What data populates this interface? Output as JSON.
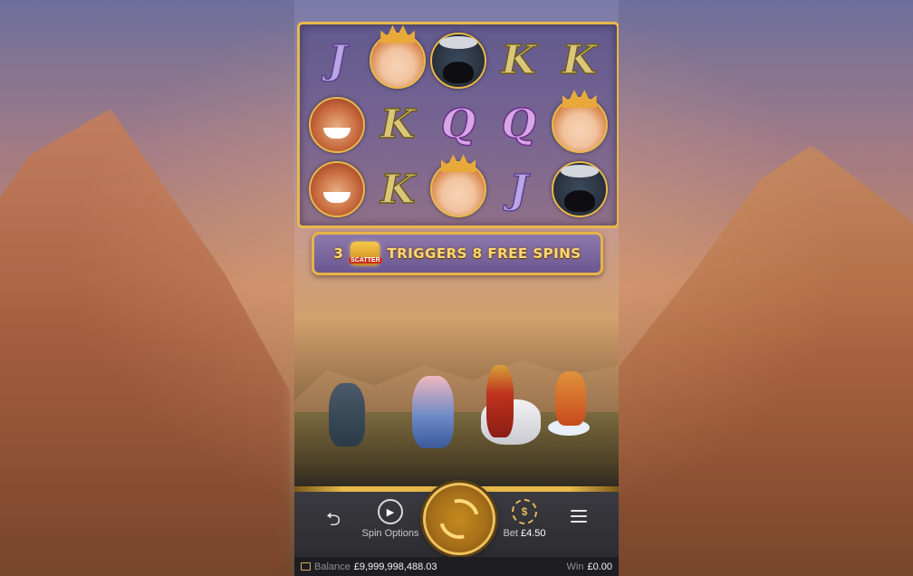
{
  "reels": {
    "rows": [
      [
        {
          "kind": "letter",
          "value": "J"
        },
        {
          "kind": "face",
          "name": "king"
        },
        {
          "kind": "face",
          "name": "sandy"
        },
        {
          "kind": "letter",
          "value": "K"
        },
        {
          "kind": "letter",
          "value": "K"
        }
      ],
      [
        {
          "kind": "face",
          "name": "monkey"
        },
        {
          "kind": "letter",
          "value": "K"
        },
        {
          "kind": "letter",
          "value": "Q"
        },
        {
          "kind": "letter",
          "value": "Q"
        },
        {
          "kind": "face",
          "name": "king"
        }
      ],
      [
        {
          "kind": "face",
          "name": "monkey"
        },
        {
          "kind": "letter",
          "value": "K"
        },
        {
          "kind": "face",
          "name": "king"
        },
        {
          "kind": "letter",
          "value": "J"
        },
        {
          "kind": "face",
          "name": "sandy"
        }
      ]
    ]
  },
  "banner": {
    "count": "3",
    "scatter_label": "SCATTER",
    "text": "TRIGGERS 8 FREE SPINS"
  },
  "controls": {
    "spin_options_label": "Spin Options",
    "bet_label": "Bet",
    "bet_value": "£4.50"
  },
  "status": {
    "balance_label": "Balance",
    "balance_value": "£9,999,998,488.03",
    "win_label": "Win",
    "win_value": "£0.00"
  },
  "colors": {
    "gold": "#e9b84a",
    "banner_text": "#ffd870"
  },
  "icons": {
    "undo": "undo-icon",
    "spin_options": "play-icon",
    "spin": "spin-icon",
    "bet": "coin-icon",
    "menu": "menu-icon",
    "balance": "wallet-icon"
  }
}
